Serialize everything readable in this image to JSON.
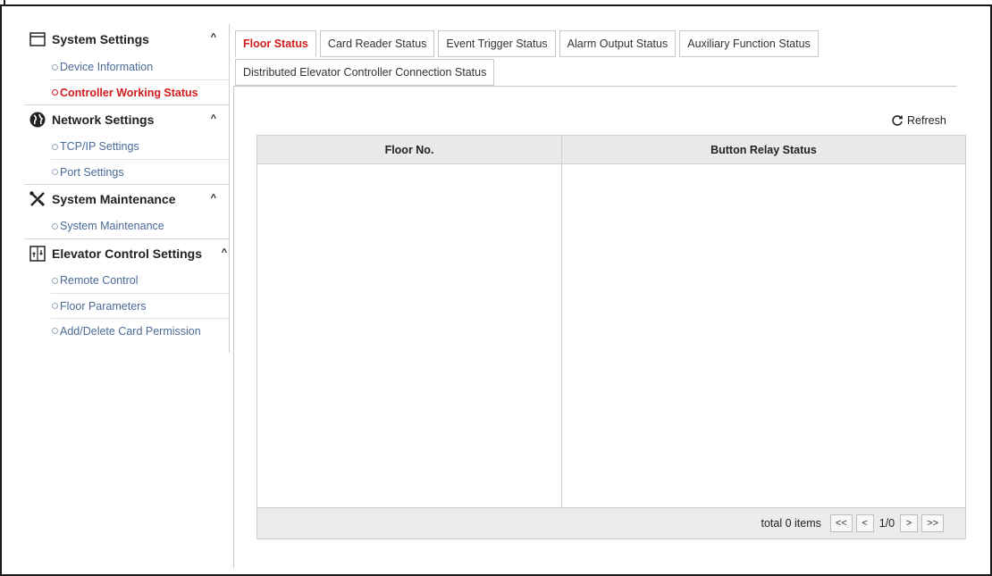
{
  "sidebar": {
    "groups": [
      {
        "title": "System Settings",
        "icon": "window-icon",
        "caret": "^",
        "items": [
          {
            "label": "Device Information",
            "active": false
          },
          {
            "label": "Controller Working Status",
            "active": true
          }
        ]
      },
      {
        "title": "Network Settings",
        "icon": "globe-icon",
        "caret": "^",
        "items": [
          {
            "label": "TCP/IP Settings",
            "active": false
          },
          {
            "label": "Port Settings",
            "active": false
          }
        ]
      },
      {
        "title": "System Maintenance",
        "icon": "tools-icon",
        "caret": "^",
        "items": [
          {
            "label": "System Maintenance",
            "active": false
          }
        ]
      },
      {
        "title": "Elevator Control Settings",
        "icon": "elevator-icon",
        "caret": "^",
        "items": [
          {
            "label": "Remote Control",
            "active": false
          },
          {
            "label": "Floor Parameters",
            "active": false
          },
          {
            "label": "Add/Delete Card Permission",
            "active": false
          }
        ]
      }
    ]
  },
  "tabs": {
    "row1": [
      "Floor Status",
      "Card Reader Status",
      "Event Trigger Status",
      "Alarm Output Status",
      "Auxiliary Function Status"
    ],
    "row2": [
      "Distributed Elevator Controller Connection Status"
    ],
    "active": "Floor Status"
  },
  "toolbar": {
    "refresh_label": "Refresh"
  },
  "table": {
    "columns": [
      "Floor No.",
      "Button Relay Status"
    ],
    "rows": []
  },
  "pagination": {
    "total_label": "total 0 items",
    "first": "<<",
    "prev": "<",
    "page": "1/0",
    "next": ">",
    "last": ">>"
  },
  "colors": {
    "active_red": "#d01c1c",
    "link_blue": "#4a6a97",
    "header_gray": "#e9e9e9"
  }
}
